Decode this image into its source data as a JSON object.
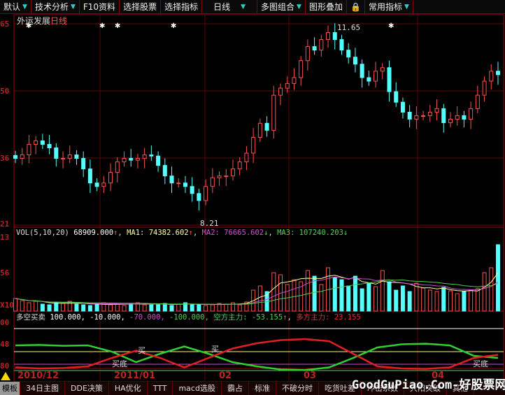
{
  "toolbar": {
    "items": [
      "默认",
      "技术分析",
      "F10资料",
      "选择股票",
      "选择指标",
      "日线",
      "多图组合",
      "图形叠加",
      "常用指标"
    ]
  },
  "main": {
    "stock": "外运发展",
    "period": "日线",
    "high_label": "11.65",
    "low_label": "8.21",
    "axis_labels": [
      "65",
      "50",
      "36",
      "21"
    ],
    "closes": [
      9.35,
      9.41,
      9.59,
      9.65,
      9.59,
      9.53,
      9.35,
      9.35,
      9.41,
      9.35,
      9.17,
      8.93,
      8.87,
      8.93,
      9.11,
      9.29,
      9.35,
      9.32,
      9.35,
      9.41,
      9.39,
      9.23,
      9.05,
      8.93,
      8.93,
      8.87,
      8.75,
      8.63,
      8.87,
      9.02,
      9.05,
      9.05,
      9.17,
      9.29,
      9.44,
      9.71,
      9.95,
      9.83,
      10.43,
      10.55,
      10.63,
      10.73,
      11.02,
      11.26,
      11.2,
      11.38,
      11.5,
      11.38,
      11.2,
      11.08,
      10.96,
      10.73,
      10.67,
      10.84,
      10.9,
      10.49,
      10.31,
      10.14,
      10.02,
      10.08,
      10.08,
      10.14,
      10.2,
      9.96,
      10.02,
      10.08,
      10.02,
      10.2,
      10.43,
      10.67,
      10.84,
      10.78
    ]
  },
  "volume": {
    "label": "VOL(5,10,20)",
    "value": "68909.000",
    "ma1_label": "MA1:",
    "ma1": "74382.602",
    "ma2_label": "MA2:",
    "ma2": "76665.602",
    "ma3_label": "MA3:",
    "ma3": "107240.203",
    "axis_labels": [
      "13",
      "56",
      "X10"
    ],
    "values": [
      18,
      15,
      12,
      14,
      10,
      9,
      12,
      11,
      14,
      10,
      9,
      8,
      10,
      12,
      9,
      10,
      8,
      11,
      12,
      9,
      10,
      9,
      11,
      8,
      10,
      12,
      9,
      10,
      8,
      9,
      11,
      10,
      12,
      9,
      13,
      30,
      36,
      28,
      55,
      52,
      38,
      45,
      42,
      58,
      50,
      38,
      62,
      48,
      45,
      36,
      50,
      32,
      40,
      35,
      58,
      42,
      30,
      36,
      28,
      40,
      33,
      30,
      28,
      34,
      29,
      25,
      28,
      30,
      32,
      55,
      62,
      95
    ]
  },
  "indicator": {
    "name": "多空买卖",
    "v1": "100.000,",
    "v2": "-10.000,",
    "v3": "-70.000,",
    "v4": "-100.000,",
    "short_label": "空方主力:",
    "short_val": "-53.155",
    "long_label": "多方主力:",
    "long_val": "23.155",
    "axis_labels": [
      "00",
      "48",
      "80"
    ],
    "buy_label": "买",
    "buy_bottom_label": "买底",
    "green": [
      20,
      22,
      18,
      20,
      -10,
      -60,
      -20,
      15,
      -20,
      -60,
      -80,
      -95,
      -98,
      -85,
      -40,
      10,
      25,
      28,
      20,
      -30,
      -40
    ],
    "red": [
      -85,
      -90,
      -88,
      -80,
      -40,
      -5,
      -40,
      -85,
      -40,
      5,
      30,
      45,
      50,
      40,
      -20,
      -80,
      -90,
      -92,
      -85,
      -40,
      -25
    ]
  },
  "dates": [
    "2010/12",
    "2011/01",
    "02",
    "03",
    "04"
  ],
  "tabs": [
    "模板",
    "34日主图",
    "DDE决策",
    "HA优化",
    "TTT",
    "macd选股",
    "霸占",
    "标准",
    "不破分时",
    "吃货吐差",
    "冲击系数",
    "大阳突破",
    "其他"
  ],
  "watermark": "GoodGuPiao.Com-好股票网",
  "colors": {
    "up": "#ff5050",
    "down": "#54ffff",
    "frame": "#a00000",
    "ma1": "#ffffa0",
    "ma2": "#d050d0",
    "ma3": "#50d050"
  }
}
